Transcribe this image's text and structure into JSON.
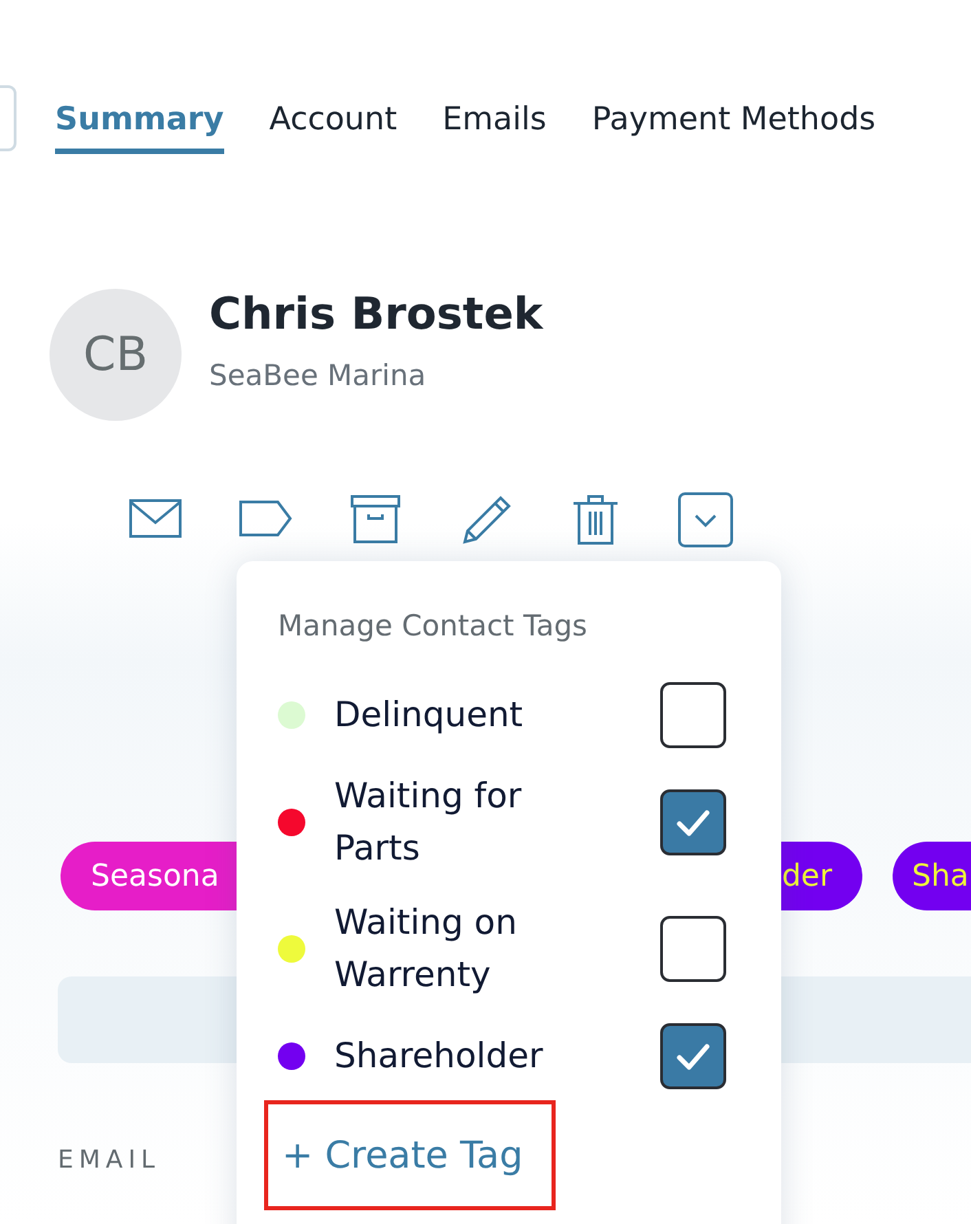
{
  "tabs": [
    {
      "label": "Summary",
      "selected": true
    },
    {
      "label": "Account",
      "selected": false
    },
    {
      "label": "Emails",
      "selected": false
    },
    {
      "label": "Payment Methods",
      "selected": false
    }
  ],
  "contact": {
    "initials": "CB",
    "name": "Chris Brostek",
    "company": "SeaBee Marina"
  },
  "actions": [
    {
      "kind": "email"
    },
    {
      "kind": "tag"
    },
    {
      "kind": "archive"
    },
    {
      "kind": "edit"
    },
    {
      "kind": "delete"
    },
    {
      "kind": "more"
    }
  ],
  "tags": [
    {
      "label": "Seasona",
      "color": "#e61ec8",
      "kind": "light"
    },
    {
      "label": "der",
      "color": "#7300f0",
      "kind": "accent"
    },
    {
      "label": "Sha",
      "color": "#7300f0",
      "kind": "accent"
    }
  ],
  "tag_menu": {
    "title": "Manage Contact Tags",
    "items": [
      {
        "name": "Delinquent",
        "color": "#dcfad2",
        "checked": false
      },
      {
        "name": "Waiting for Parts",
        "color": "#f5082d",
        "checked": true
      },
      {
        "name": "Waiting on Warrenty",
        "color": "#eefa3c",
        "checked": false
      },
      {
        "name": "Shareholder",
        "color": "#7300f0",
        "checked": true
      }
    ],
    "create_label": "+ Create Tag"
  },
  "email_label": "EMAIL"
}
